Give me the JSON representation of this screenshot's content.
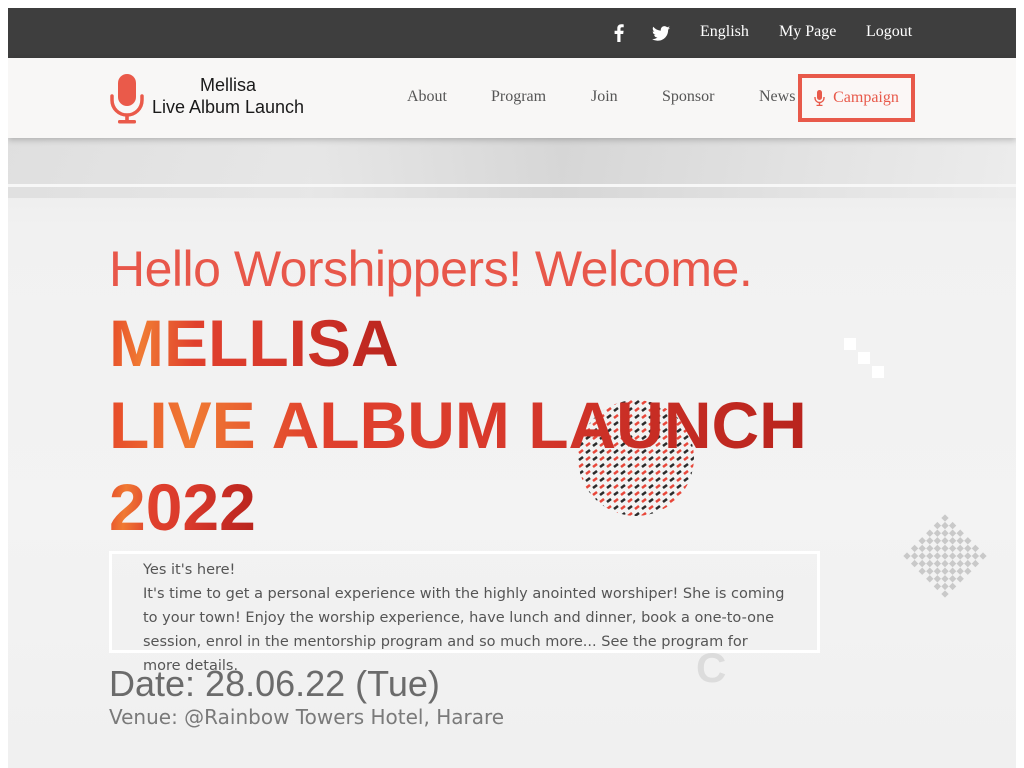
{
  "topbar": {
    "icons": [
      "facebook-icon",
      "twitter-icon"
    ],
    "links": [
      "English",
      "My Page",
      "Logout"
    ]
  },
  "header": {
    "logo_line1": "Mellisa",
    "logo_line2": "Live Album Launch",
    "logo_icon": "microphone-icon",
    "nav": [
      "About",
      "Program",
      "Join",
      "Sponsor",
      "News"
    ],
    "cta_label": "Campaign",
    "cta_icon": "microphone-icon"
  },
  "hero": {
    "greeting": "Hello Worshippers! Welcome.",
    "title_line1": "MELLISA",
    "title_line2": "LIVE ALBUM LAUNCH",
    "title_line3": "2022",
    "intro_line1": "Yes it's here!",
    "intro_line2": "It's time to get a personal experience with the highly anointed worshiper! She is coming to your town! Enjoy the worship experience, have lunch and dinner, book a one-to-one session, enrol in the mentorship program and so much more... See the program for more details.",
    "date": "Date: 28.06.22 (Tue)",
    "venue": "Venue: @Rainbow Towers Hotel, Harare"
  },
  "colors": {
    "accent": "#e8594a",
    "topbar_bg": "#3e3e3e",
    "header_bg": "#f8f7f6",
    "hero_bg": "#f1f1f1",
    "text_muted": "#555555"
  }
}
